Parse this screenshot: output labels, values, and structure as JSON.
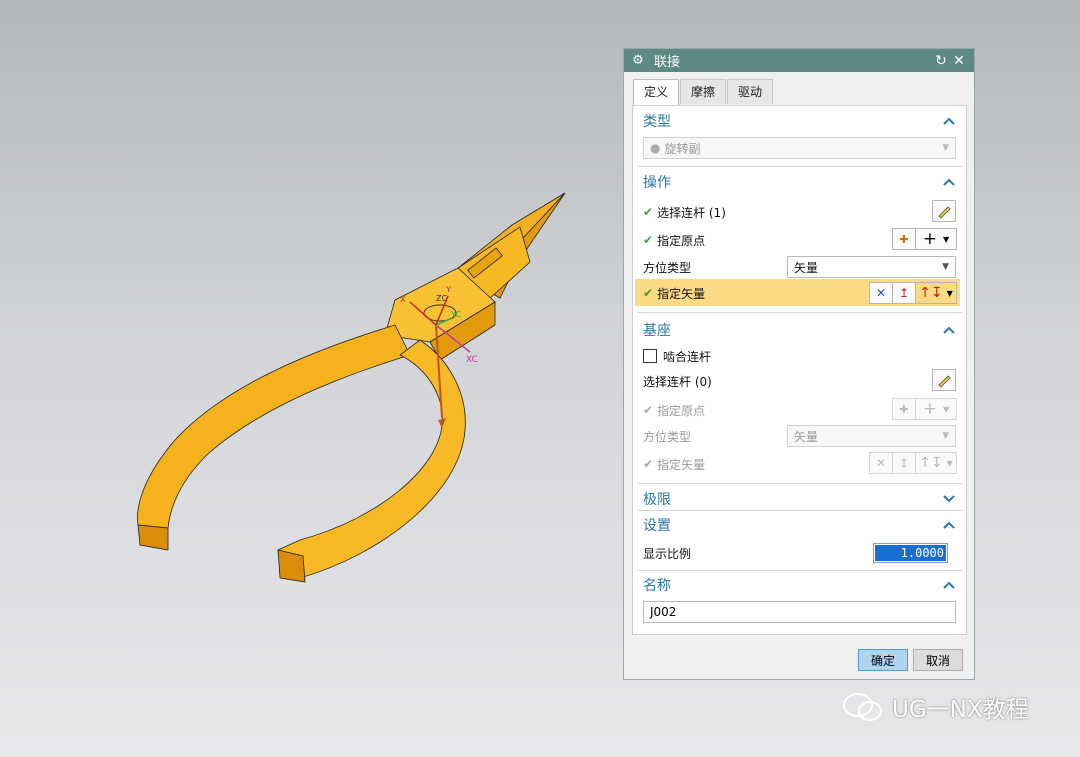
{
  "dialog": {
    "title": "联接",
    "tabs": [
      {
        "label": "定义",
        "active": true
      },
      {
        "label": "摩擦",
        "active": false
      },
      {
        "label": "驱动",
        "active": false
      }
    ],
    "type_section": {
      "title": "类型",
      "value": "旋转副"
    },
    "operation_section": {
      "title": "操作",
      "select_link": "选择连杆 (1)",
      "specify_origin": "指定原点",
      "orientation_type_label": "方位类型",
      "orientation_type_value": "矢量",
      "specify_vector": "指定矢量"
    },
    "base_section": {
      "title": "基座",
      "snap_link_label": "啮合连杆",
      "snap_link_checked": false,
      "select_link": "选择连杆 (0)",
      "specify_origin": "指定原点",
      "orientation_type_label": "方位类型",
      "orientation_type_value": "矢量",
      "specify_vector": "指定矢量"
    },
    "limits_section": {
      "title": "极限"
    },
    "settings_section": {
      "title": "设置",
      "display_scale_label": "显示比例",
      "display_scale_value": "1.0000"
    },
    "name_section": {
      "title": "名称",
      "value": "J002"
    },
    "ok_label": "确定",
    "cancel_label": "取消"
  },
  "viewport": {
    "axis_labels": {
      "x": "X",
      "y": "Y",
      "zc": "ZC",
      "yc": "YC",
      "xc": "XC"
    }
  },
  "watermark": "UG一NX教程",
  "colors": {
    "title_bar": "#5d8a84",
    "section_title": "#2a77ad",
    "highlight": "#fbd985",
    "model": "#f6b21c",
    "check": "#3aa03a"
  }
}
